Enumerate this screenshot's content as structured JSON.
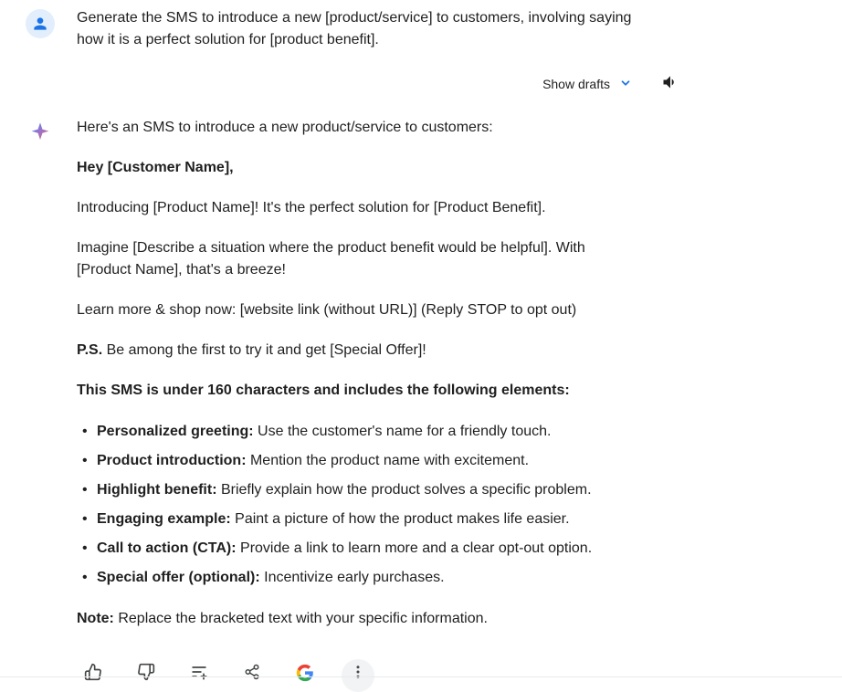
{
  "user": {
    "prompt": "Generate the SMS to introduce a new [product/service] to customers, involving saying how it is a perfect solution for [product benefit]."
  },
  "controls": {
    "show_drafts": "Show drafts"
  },
  "response": {
    "intro": "Here's an SMS to introduce a new product/service to customers:",
    "greeting_bold": "Hey [Customer Name],",
    "p1": "Introducing [Product Name]!  It's the perfect solution for [Product Benefit].",
    "p2": "Imagine [Describe a situation where the product benefit would be helpful]. With [Product Name], that's a breeze!",
    "p3": "Learn more & shop now: [website link (without URL)]  (Reply STOP to opt out)",
    "ps_label": "P.S.",
    "ps_text": " Be among the first to try it and get [Special Offer]!",
    "subhead": "This SMS is under 160 characters and includes the following elements:",
    "bullets": [
      {
        "label": "Personalized greeting:",
        "text": " Use the customer's name for a friendly touch."
      },
      {
        "label": "Product introduction:",
        "text": " Mention the product name with excitement."
      },
      {
        "label": "Highlight benefit:",
        "text": " Briefly explain how the product solves a specific problem."
      },
      {
        "label": "Engaging example:",
        "text": " Paint a picture of how the product makes life easier."
      },
      {
        "label": "Call to action (CTA):",
        "text": " Provide a link to learn more and a clear opt-out option."
      },
      {
        "label": "Special offer (optional):",
        "text": " Incentivize early purchases."
      }
    ],
    "note_label": "Note:",
    "note_text": " Replace the bracketed text with your specific information."
  }
}
